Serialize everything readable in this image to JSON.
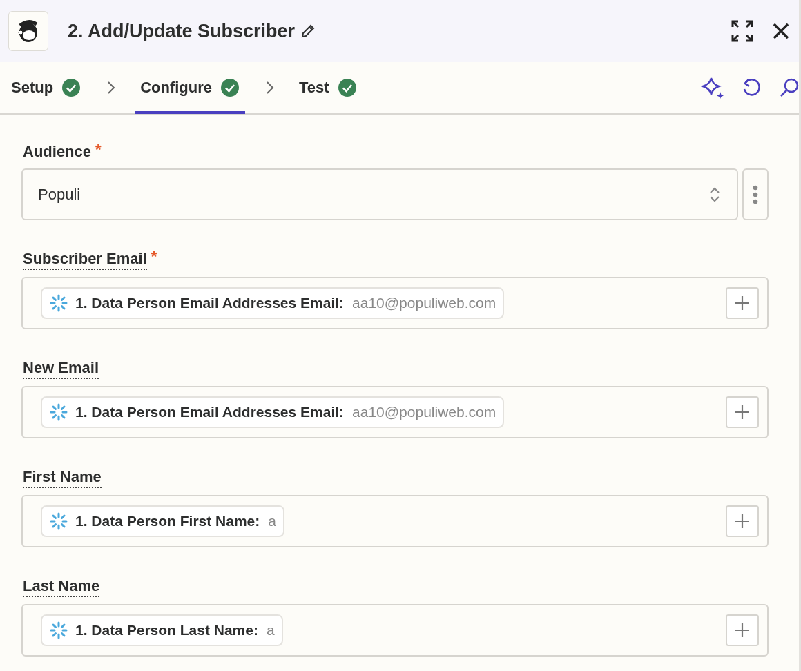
{
  "header": {
    "title": "2. Add/Update Subscriber"
  },
  "tabs": [
    {
      "label": "Setup",
      "selected": false,
      "complete": true
    },
    {
      "label": "Configure",
      "selected": true,
      "complete": true
    },
    {
      "label": "Test",
      "selected": false,
      "complete": true
    }
  ],
  "fields": [
    {
      "kind": "select",
      "label": "Audience",
      "required_mark": "*",
      "value": "Populi"
    },
    {
      "kind": "mapped",
      "label": "Subscriber Email",
      "required_mark": "*",
      "token": {
        "label": "1. Data Person Email Addresses Email:",
        "value": "aa10@populiweb.com"
      }
    },
    {
      "kind": "mapped",
      "label": "New Email",
      "token": {
        "label": "1. Data Person Email Addresses Email:",
        "value": "aa10@populiweb.com"
      }
    },
    {
      "kind": "mapped",
      "label": "First Name",
      "token": {
        "label": "1. Data Person First Name:",
        "value": "a"
      }
    },
    {
      "kind": "mapped",
      "label": "Last Name",
      "token": {
        "label": "1. Data Person Last Name:",
        "value": "a"
      }
    }
  ]
}
